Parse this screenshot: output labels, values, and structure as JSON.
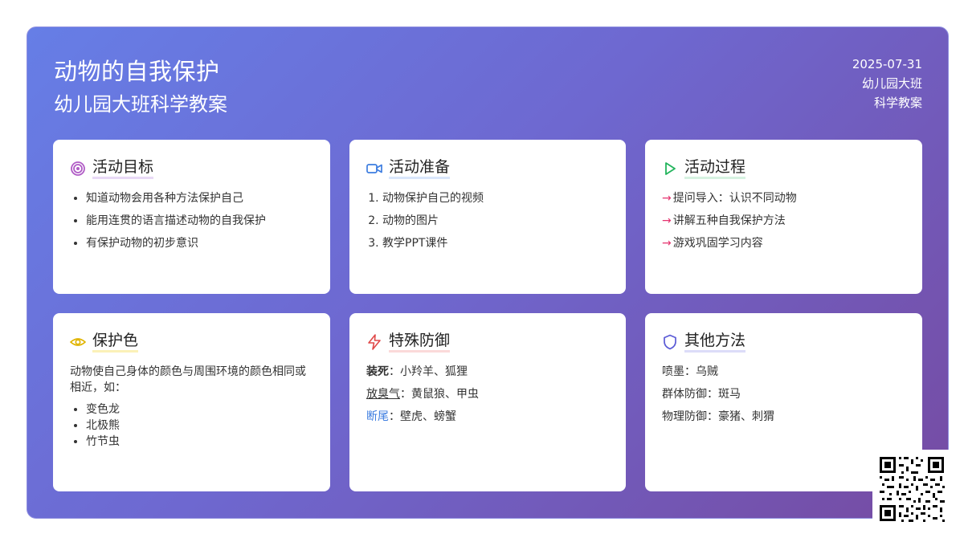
{
  "header": {
    "title": "动物的自我保护",
    "subtitle": "幼儿园大班科学教案",
    "date": "2025-07-31",
    "grade": "幼儿园大班",
    "subject": "科学教案"
  },
  "cards": {
    "goals": {
      "title": "活动目标",
      "icon": "target-icon",
      "items": [
        "知道动物会用各种方法保护自己",
        "能用连贯的语言描述动物的自我保护",
        "有保护动物的初步意识"
      ]
    },
    "prep": {
      "title": "活动准备",
      "icon": "video-icon",
      "items": [
        "动物保护自己的视频",
        "动物的图片",
        "教学PPT课件"
      ]
    },
    "process": {
      "title": "活动过程",
      "icon": "play-icon",
      "arrow": "→",
      "items": [
        "提问导入：认识不同动物",
        "讲解五种自我保护方法",
        "游戏巩固学习内容"
      ]
    },
    "camouflage": {
      "title": "保护色",
      "icon": "eye-icon",
      "desc": "动物使自己身体的颜色与周围环境的颜色相同或相近，如：",
      "items": [
        "变色龙",
        "北极熊",
        "竹节虫"
      ]
    },
    "defense": {
      "title": "特殊防御",
      "icon": "lightning-icon",
      "rows": [
        {
          "term": "装死",
          "sep": "：",
          "value": "小羚羊、狐狸"
        },
        {
          "term": "放臭气",
          "sep": "：",
          "value": "黄鼠狼、甲虫"
        },
        {
          "term": "断尾",
          "sep": "：",
          "value": "壁虎、螃蟹"
        }
      ]
    },
    "other": {
      "title": "其他方法",
      "icon": "shield-icon",
      "rows": [
        "喷墨：乌贼",
        "群体防御：斑马",
        "物理防御：豪猪、刺猬"
      ]
    }
  },
  "colors": {
    "gradient_start": "#667ee6",
    "gradient_end": "#764ba2",
    "target": "#b05cc6",
    "video": "#3d7de0",
    "play": "#22b45c",
    "eye": "#e0b400",
    "lightning": "#e04848",
    "shield": "#5b5bd6",
    "arrow": "#e5326e"
  },
  "qr_icon": "qr-code-icon"
}
